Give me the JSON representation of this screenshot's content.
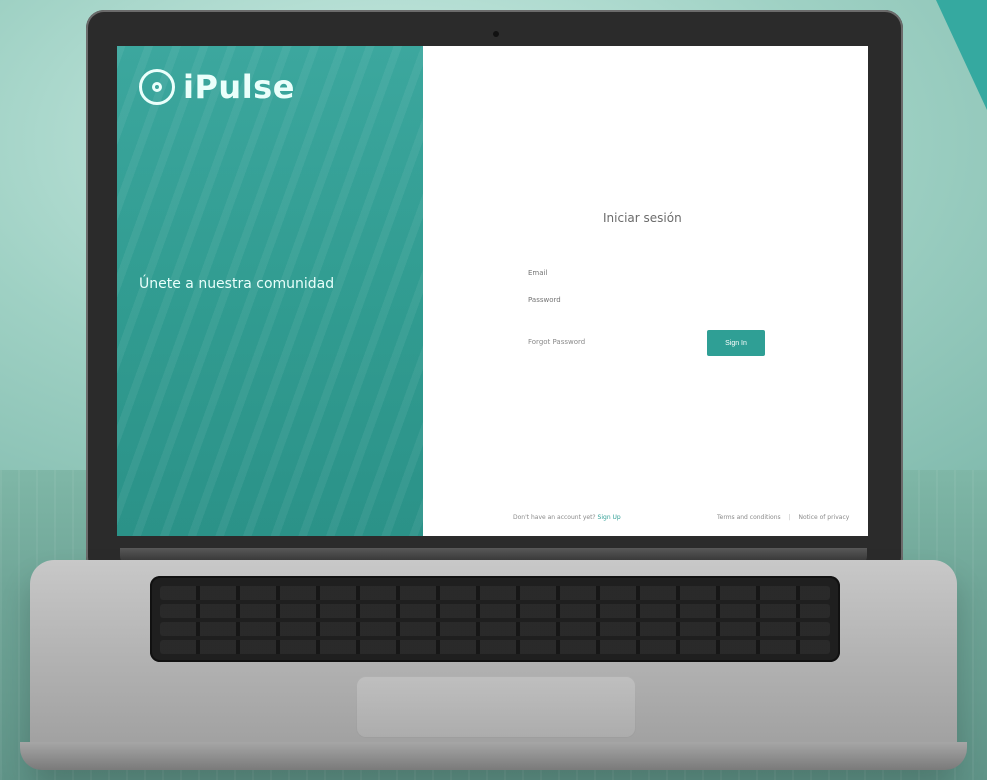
{
  "brand": {
    "name": "iPulse",
    "tagline": ""
  },
  "left_panel": {
    "title": "Únete a nuestra comunidad",
    "description": "",
    "footer": ""
  },
  "login": {
    "title": "Iniciar sesión",
    "email_placeholder": "Email",
    "password_placeholder": "Password",
    "forgot_password": "Forgot Password",
    "sign_in": "Sign In"
  },
  "footer": {
    "no_account": "Don't have an account yet?",
    "sign_up": "Sign Up",
    "terms": "Terms and conditions",
    "privacy": "Notice of privacy"
  },
  "colors": {
    "teal": "#2f9f95",
    "teal_light": "#3fb0a6",
    "screen_bg": "#ffffff"
  }
}
